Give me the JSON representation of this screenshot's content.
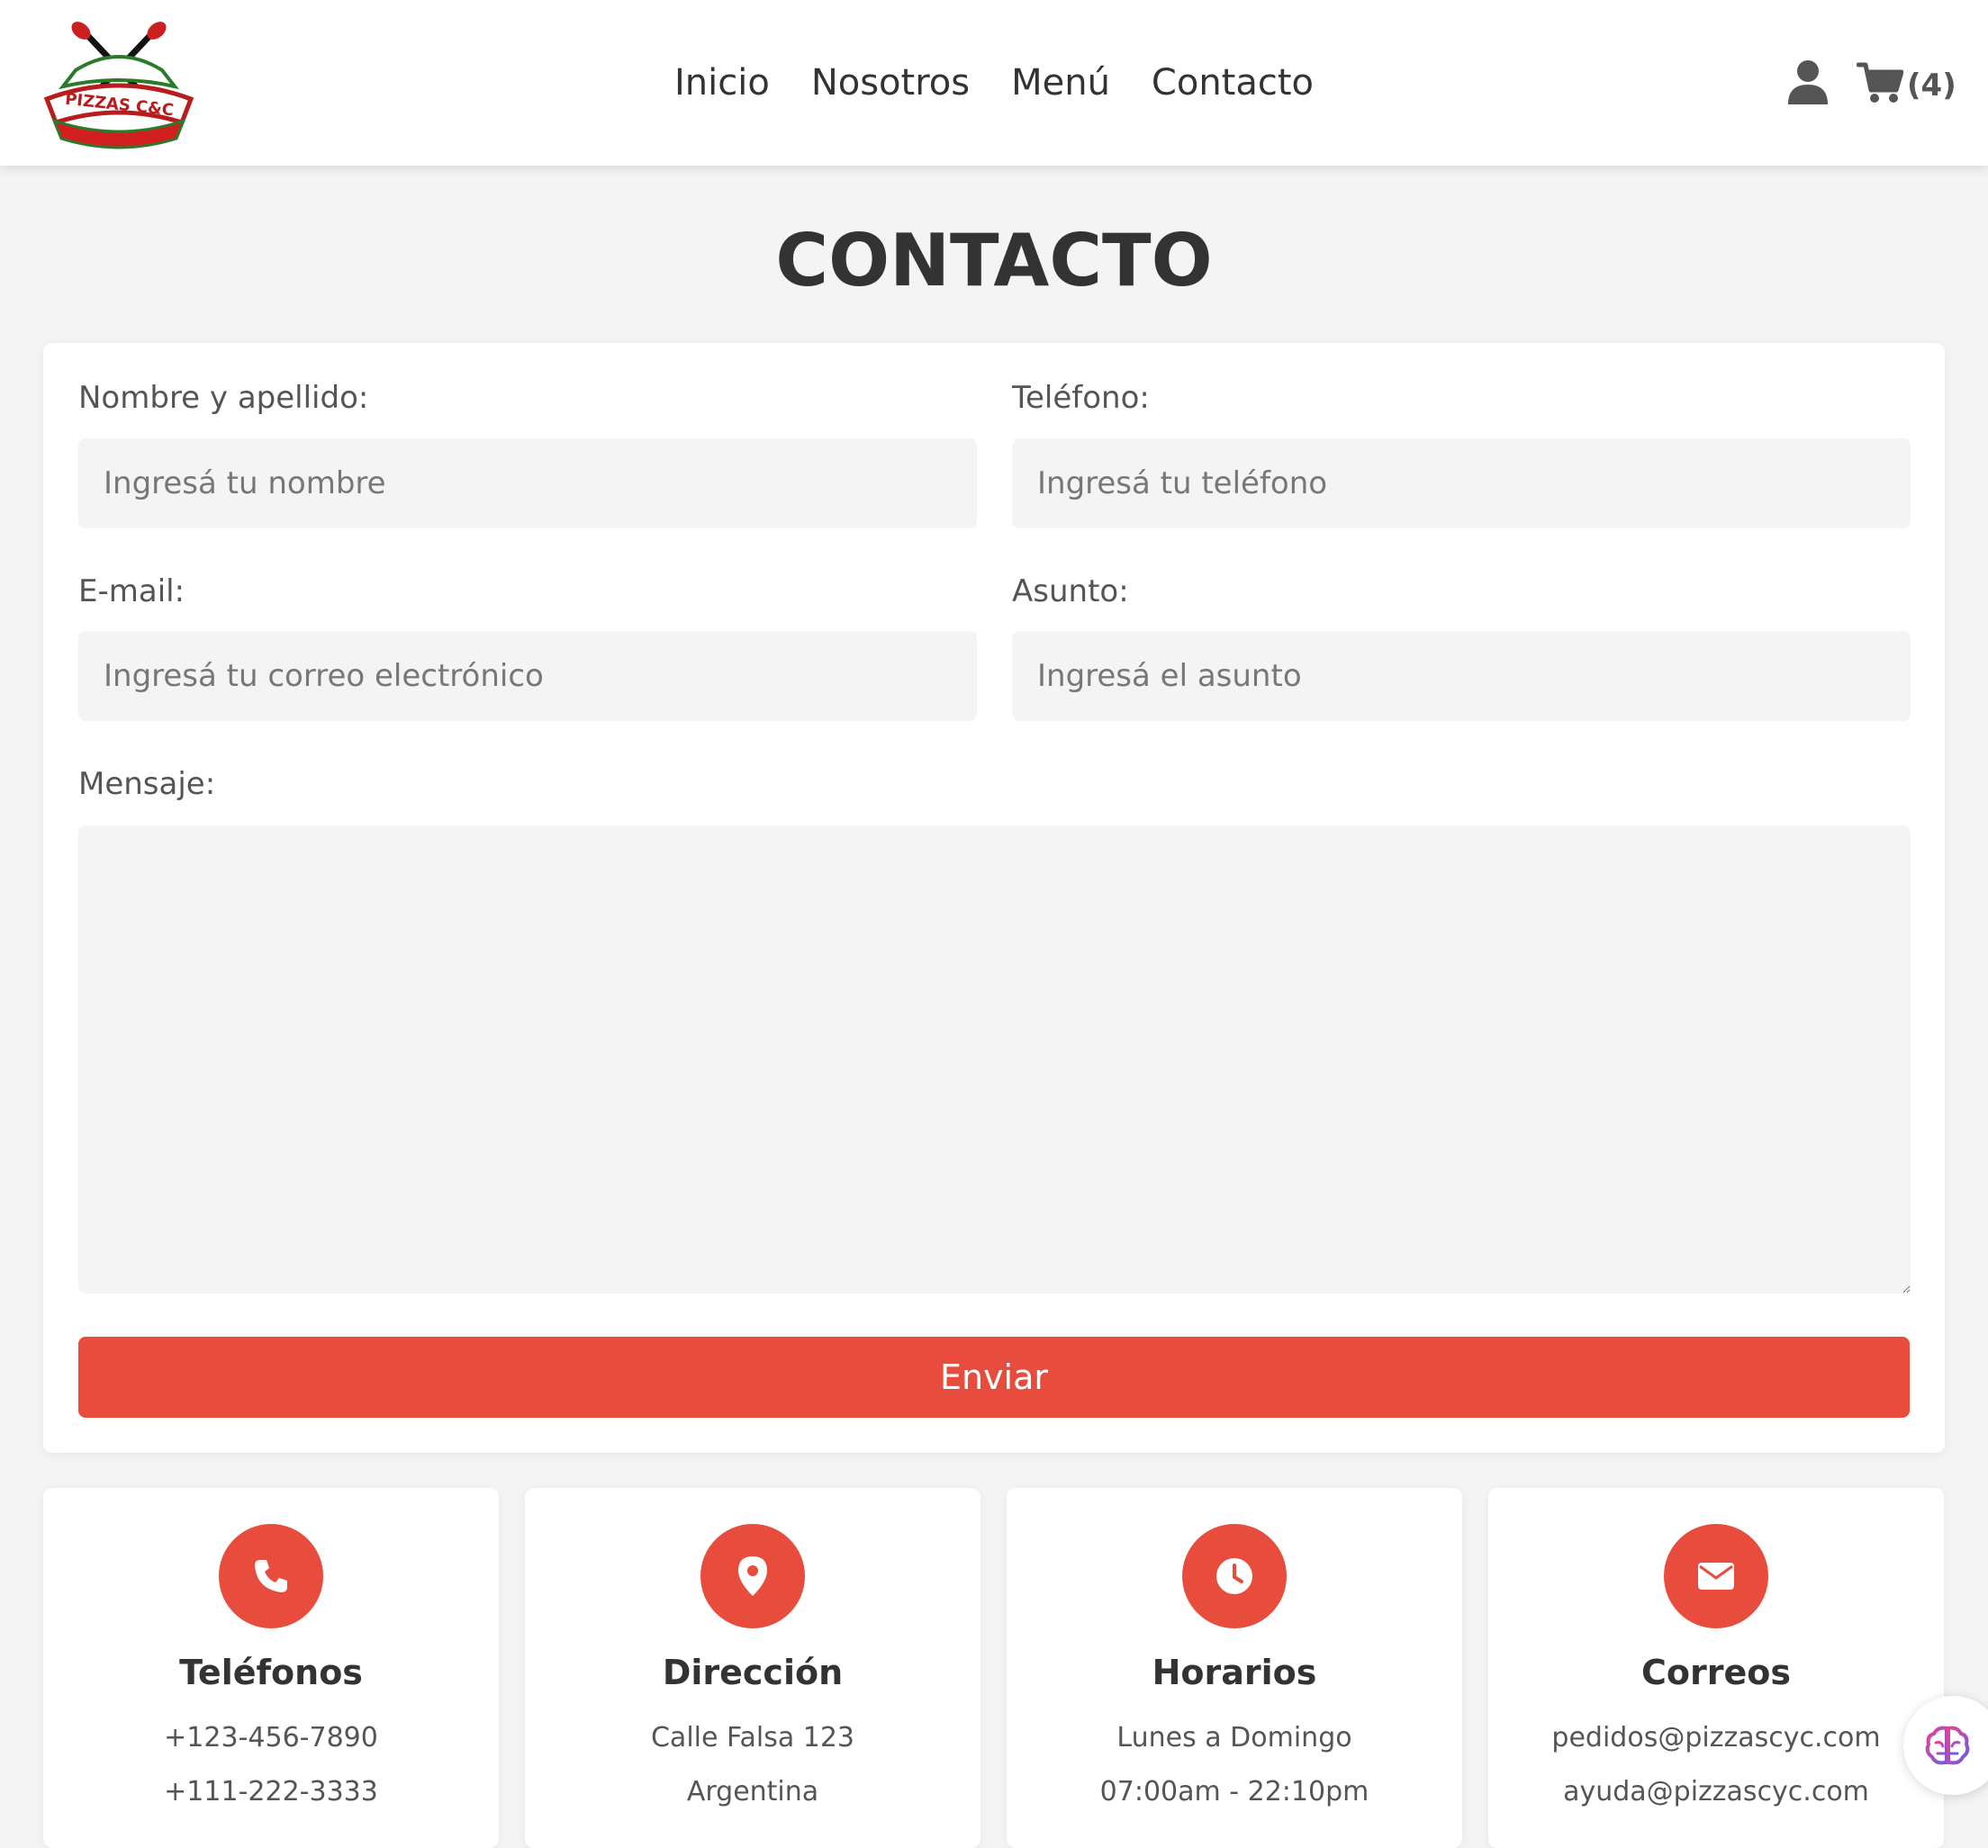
{
  "header": {
    "logo_text": "PIZZAS C&C",
    "nav": [
      "Inicio",
      "Nosotros",
      "Menú",
      "Contacto"
    ],
    "user_icon": "user-icon",
    "cart_icon": "cart-icon",
    "cart_count": "(4)"
  },
  "page": {
    "title": "CONTACTO"
  },
  "form": {
    "name_label": "Nombre y apellido:",
    "name_placeholder": "Ingresá tu nombre",
    "phone_label": "Teléfono:",
    "phone_placeholder": "Ingresá tu teléfono",
    "email_label": "E-mail:",
    "email_placeholder": "Ingresá tu correo electrónico",
    "subject_label": "Asunto:",
    "subject_placeholder": "Ingresá el asunto",
    "message_label": "Mensaje:",
    "message_value": "",
    "submit_label": "Enviar"
  },
  "info": [
    {
      "icon": "phone-icon",
      "title": "Teléfonos",
      "lines": [
        "+123-456-7890",
        "+111-222-3333"
      ]
    },
    {
      "icon": "location-pin-icon",
      "title": "Dirección",
      "lines": [
        "Calle Falsa 123",
        "Argentina"
      ]
    },
    {
      "icon": "clock-icon",
      "title": "Horarios",
      "lines": [
        "Lunes a Domingo",
        "07:00am - 22:10pm"
      ]
    },
    {
      "icon": "envelope-icon",
      "title": "Correos",
      "lines": [
        "pedidos@pizzascyc.com",
        "ayuda@pizzascyc.com"
      ]
    }
  ],
  "colors": {
    "accent": "#e74c3c",
    "background": "#f4f4f4",
    "text": "#333333"
  },
  "widget": {
    "icon": "brain-icon"
  }
}
